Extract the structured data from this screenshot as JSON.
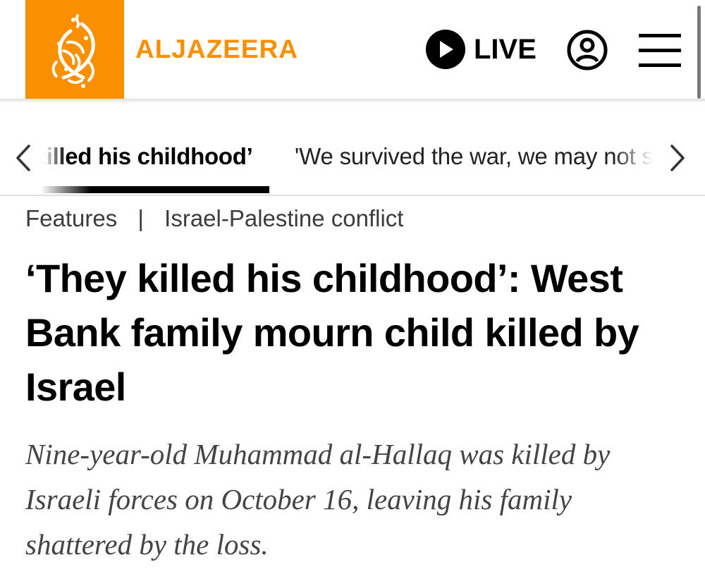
{
  "header": {
    "brand_name": "ALJAZEERA",
    "live_label": "LIVE",
    "colors": {
      "brand_orange": "#fa9000",
      "text": "#000000"
    },
    "icons": {
      "logo": "al-jazeera-calligraphy-logo",
      "live": "play-icon",
      "account": "user-account-icon",
      "menu": "hamburger-menu-icon"
    }
  },
  "ticker": {
    "prev_icon": "chevron-left-icon",
    "next_icon": "chevron-right-icon",
    "active_item": "‘They killed his childhood’",
    "next_item": "'We survived the war, we may not survive the peace'"
  },
  "article": {
    "breadcrumb": {
      "section": "Features",
      "separator": "|",
      "topic": "Israel-Palestine conflict"
    },
    "headline": "‘They killed his childhood’: West Bank family mourn child killed by Israel",
    "standfirst": "Nine-year-old Muhammad al-Hallaq was killed by Israeli forces on October 16, leaving his family shattered by the loss."
  }
}
